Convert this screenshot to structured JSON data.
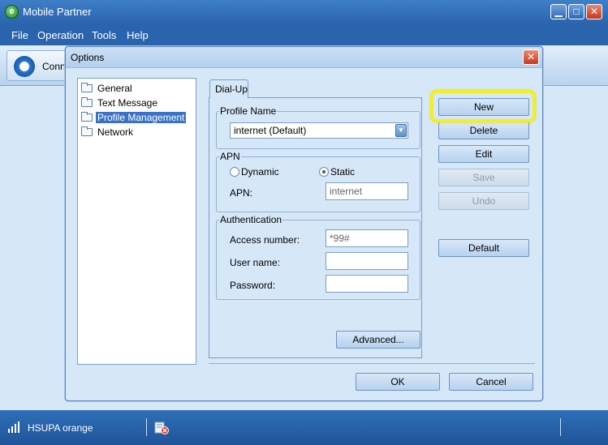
{
  "window": {
    "title": "Mobile Partner",
    "min_glyph": "▁",
    "max_glyph": "□",
    "close_glyph": "✕"
  },
  "menu": [
    "File",
    "Operation",
    "Tools",
    "Help"
  ],
  "toolbar": {
    "connect_label": "Conne"
  },
  "dialog": {
    "title": "Options",
    "close_glyph": "✕",
    "tree": [
      {
        "label": "General",
        "selected": false
      },
      {
        "label": "Text Message",
        "selected": false
      },
      {
        "label": "Profile Management",
        "selected": true
      },
      {
        "label": "Network",
        "selected": false
      }
    ],
    "tab_label": "Dial-Up",
    "profile_group": {
      "legend": "Profile Name",
      "selected_profile": "internet (Default)"
    },
    "apn_group": {
      "legend": "APN",
      "dynamic_label": "Dynamic",
      "static_label": "Static",
      "selected": "Static",
      "apn_label": "APN:",
      "apn_value": "internet"
    },
    "auth_group": {
      "legend": "Authentication",
      "access_label": "Access number:",
      "access_value": "*99#",
      "user_label": "User name:",
      "user_value": "",
      "password_label": "Password:",
      "password_value": ""
    },
    "advanced_label": "Advanced...",
    "side_buttons": {
      "new": "New",
      "delete": "Delete",
      "edit": "Edit",
      "save": "Save",
      "undo": "Undo",
      "default": "Default"
    },
    "ok_label": "OK",
    "cancel_label": "Cancel"
  },
  "status": {
    "network": "HSUPA orange"
  },
  "colors": {
    "highlight": "#f5ef1e",
    "selection": "#3a73c4"
  }
}
